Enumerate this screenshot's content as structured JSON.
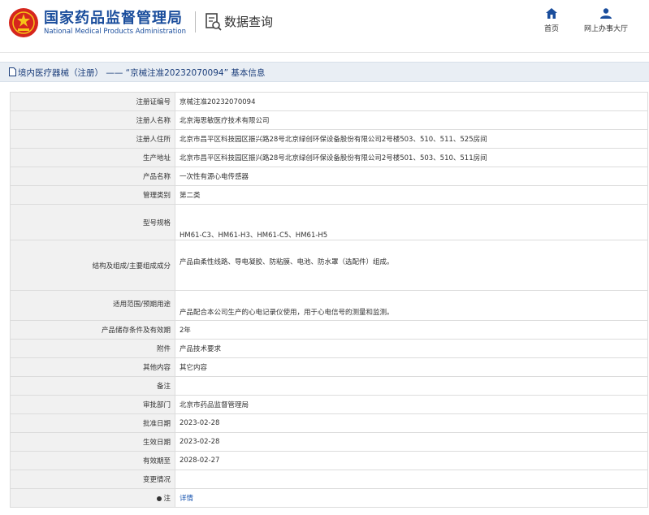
{
  "header": {
    "brand_cn": "国家药品监督管理局",
    "brand_en": "National Medical Products Administration",
    "page_title": "数据查询",
    "nav": [
      {
        "label": "首页",
        "icon": "home-icon"
      },
      {
        "label": "网上办事大厅",
        "icon": "user-icon"
      }
    ]
  },
  "section": {
    "title": "境内医疗器械（注册） —— “京械注准20232070094” 基本信息"
  },
  "rows": [
    {
      "label": "注册证编号",
      "value": "京械注准20232070094"
    },
    {
      "label": "注册人名称",
      "value": "北京海思敏医疗技术有限公司"
    },
    {
      "label": "注册人住所",
      "value": "北京市昌平区科技园区振兴路28号北京绿创环保设备股份有限公司2号楼503、510、511、525房间"
    },
    {
      "label": "生产地址",
      "value": "北京市昌平区科技园区振兴路28号北京绿创环保设备股份有限公司2号楼501、503、510、511房间"
    },
    {
      "label": "产品名称",
      "value": "一次性有源心电传感器"
    },
    {
      "label": "管理类别",
      "value": "第二类"
    },
    {
      "label": "型号规格",
      "value": "HM61-C3、HM61-H3、HM61-C5、HM61-H5"
    },
    {
      "label": "结构及组成/主要组成成分",
      "value": "产品由柔性线路、导电凝胶、防粘膜、电池、防水罩（选配件）组成。"
    },
    {
      "label": "适用范围/预期用途",
      "value": "产品配合本公司生产的心电记录仪使用，用于心电信号的测量和监测。"
    },
    {
      "label": "产品储存条件及有效期",
      "value": "2年"
    },
    {
      "label": "附件",
      "value": "产品技术要求"
    },
    {
      "label": "其他内容",
      "value": "其它内容"
    },
    {
      "label": "备注",
      "value": ""
    },
    {
      "label": "审批部门",
      "value": "北京市药品监督管理局"
    },
    {
      "label": "批准日期",
      "value": "2023-02-28"
    },
    {
      "label": "生效日期",
      "value": "2023-02-28"
    },
    {
      "label": "有效期至",
      "value": "2028-02-27"
    },
    {
      "label": "变更情况",
      "value": ""
    },
    {
      "label": "注",
      "value": "详情"
    }
  ],
  "colors": {
    "brand": "#1a4d9c",
    "link": "#1a56b0",
    "section_bg": "#e9eef4",
    "label_bg": "#f1f1f1",
    "emblem": "#d6261d"
  }
}
